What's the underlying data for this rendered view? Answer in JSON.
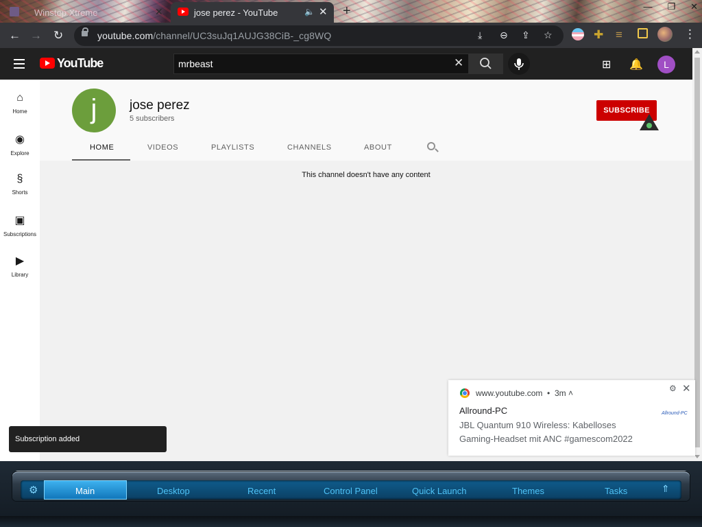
{
  "browser": {
    "tabs": [
      {
        "title": "Winstep Xtreme",
        "active": false
      },
      {
        "title": "jose perez - YouTube",
        "active": true
      }
    ],
    "new_tab_icon": "+",
    "window_buttons": [
      "—",
      "❐",
      "✕"
    ],
    "address": {
      "host": "youtube.com",
      "path": "/channel/UC3suJq1AUJG38CiB-_cg8WQ"
    }
  },
  "youtube": {
    "logo_text": "YouTube",
    "search": {
      "value": "mrbeast"
    },
    "avatar_initial": "L",
    "guide": [
      {
        "label": "Home",
        "icon": "home-icon"
      },
      {
        "label": "Explore",
        "icon": "compass-icon"
      },
      {
        "label": "Shorts",
        "icon": "shorts-icon"
      },
      {
        "label": "Subscriptions",
        "icon": "subscriptions-icon"
      },
      {
        "label": "Library",
        "icon": "library-icon"
      }
    ],
    "channel": {
      "initial": "j",
      "name": "jose perez",
      "subscribers": "5 subscribers",
      "subscribe_label": "SUBSCRIBE",
      "tabs": [
        "HOME",
        "VIDEOS",
        "PLAYLISTS",
        "CHANNELS",
        "ABOUT"
      ],
      "active_tab": "HOME",
      "empty_message": "This channel doesn't have any content"
    }
  },
  "notification": {
    "source": "www.youtube.com",
    "age": "3m",
    "title": "Allround-PC",
    "body": "JBL Quantum 910 Wireless: Kabelloses Gaming-Headset mit ANC #gamescom2022",
    "badge": "Allround-PC"
  },
  "toast": {
    "text": "Subscription added"
  },
  "taskbar": {
    "items": [
      "Main",
      "Desktop",
      "Recent",
      "Control Panel",
      "Quick Launch",
      "Themes",
      "Tasks"
    ],
    "active": "Main"
  },
  "colors": {
    "youtube_red": "#ff0000",
    "subscribe_red": "#cc0000",
    "channel_avatar": "#6c9e3c",
    "user_avatar": "#a04fc4",
    "taskbar_accent": "#4fc3f7"
  }
}
